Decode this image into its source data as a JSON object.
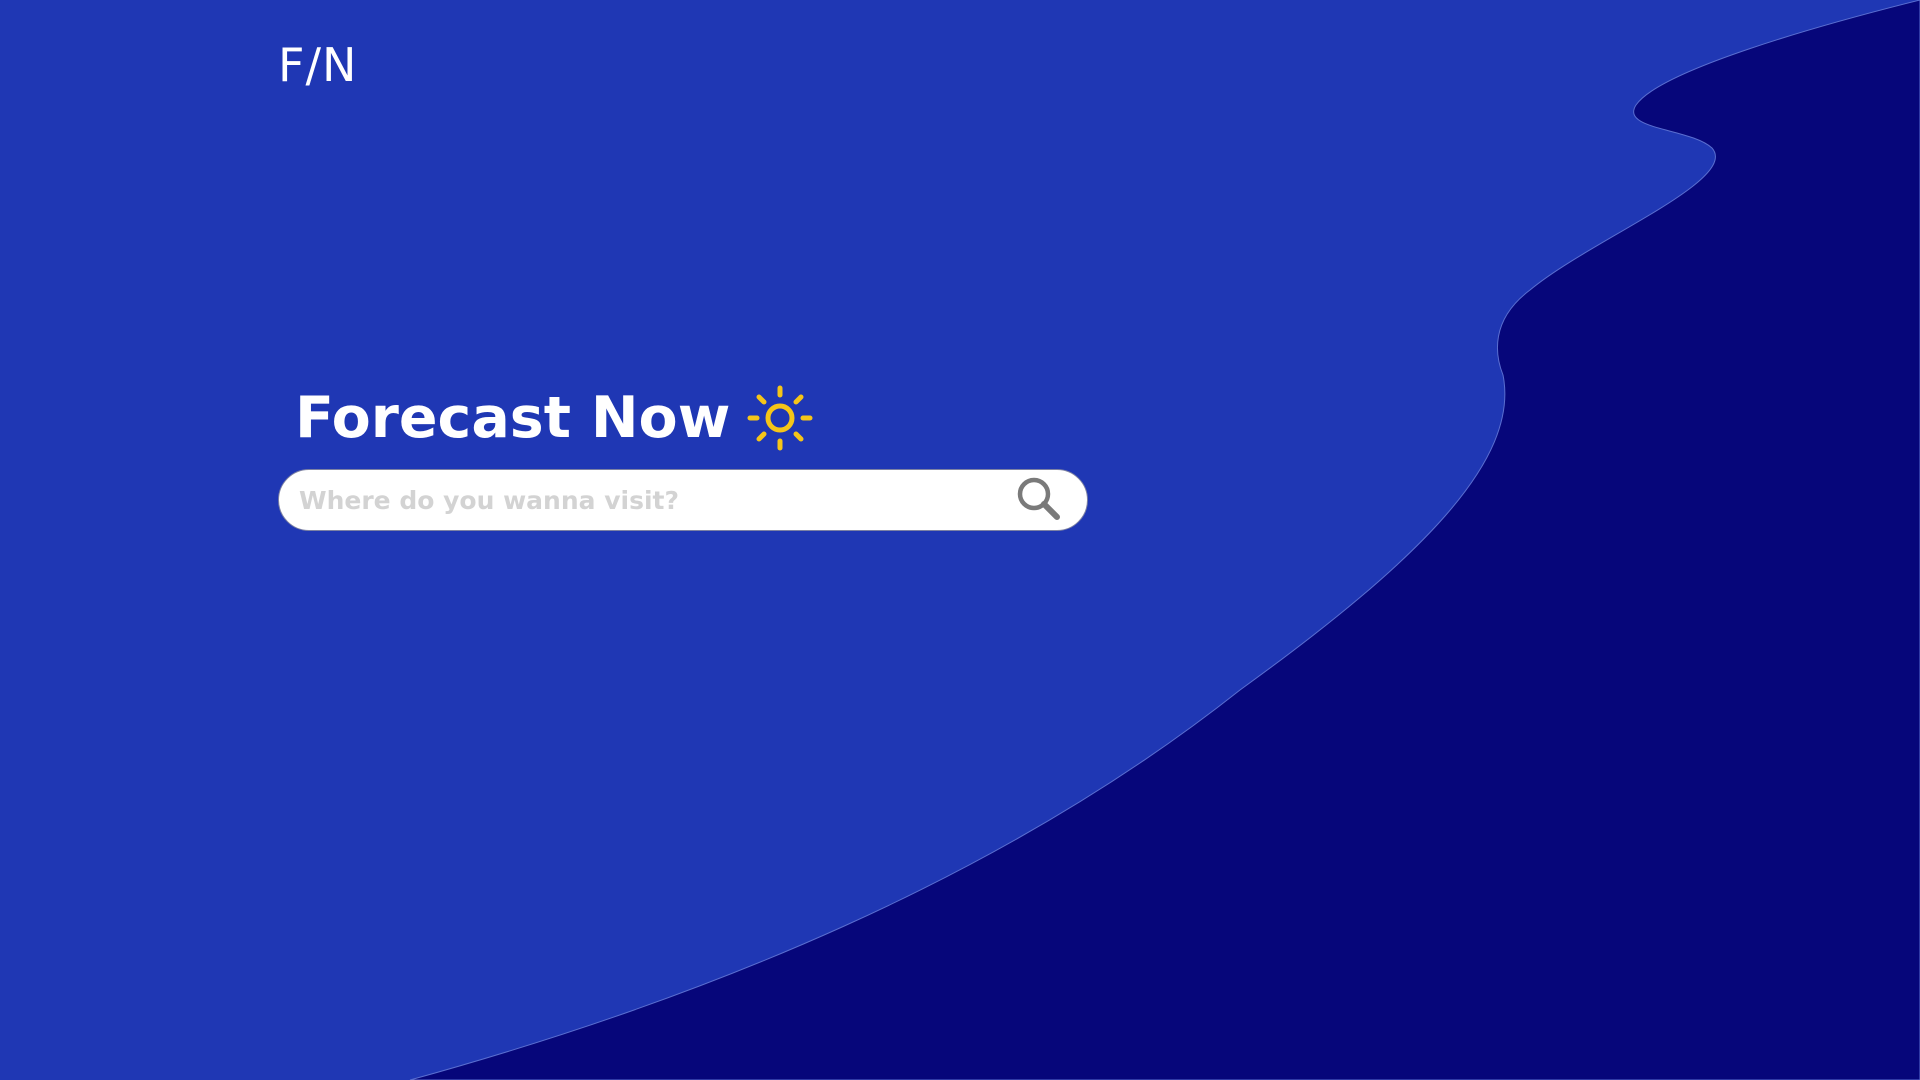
{
  "brand": {
    "logo_text": "F/N"
  },
  "hero": {
    "title": "Forecast Now",
    "title_icon": "sun-icon"
  },
  "search": {
    "placeholder": "Where do you wanna visit?",
    "value": "",
    "icon": "search-icon"
  },
  "colors": {
    "background": "#1f37b4",
    "wave": "#06067a",
    "accent_sun": "#f5c518",
    "search_icon": "#7a7a7a",
    "placeholder": "#d3d3d3"
  }
}
